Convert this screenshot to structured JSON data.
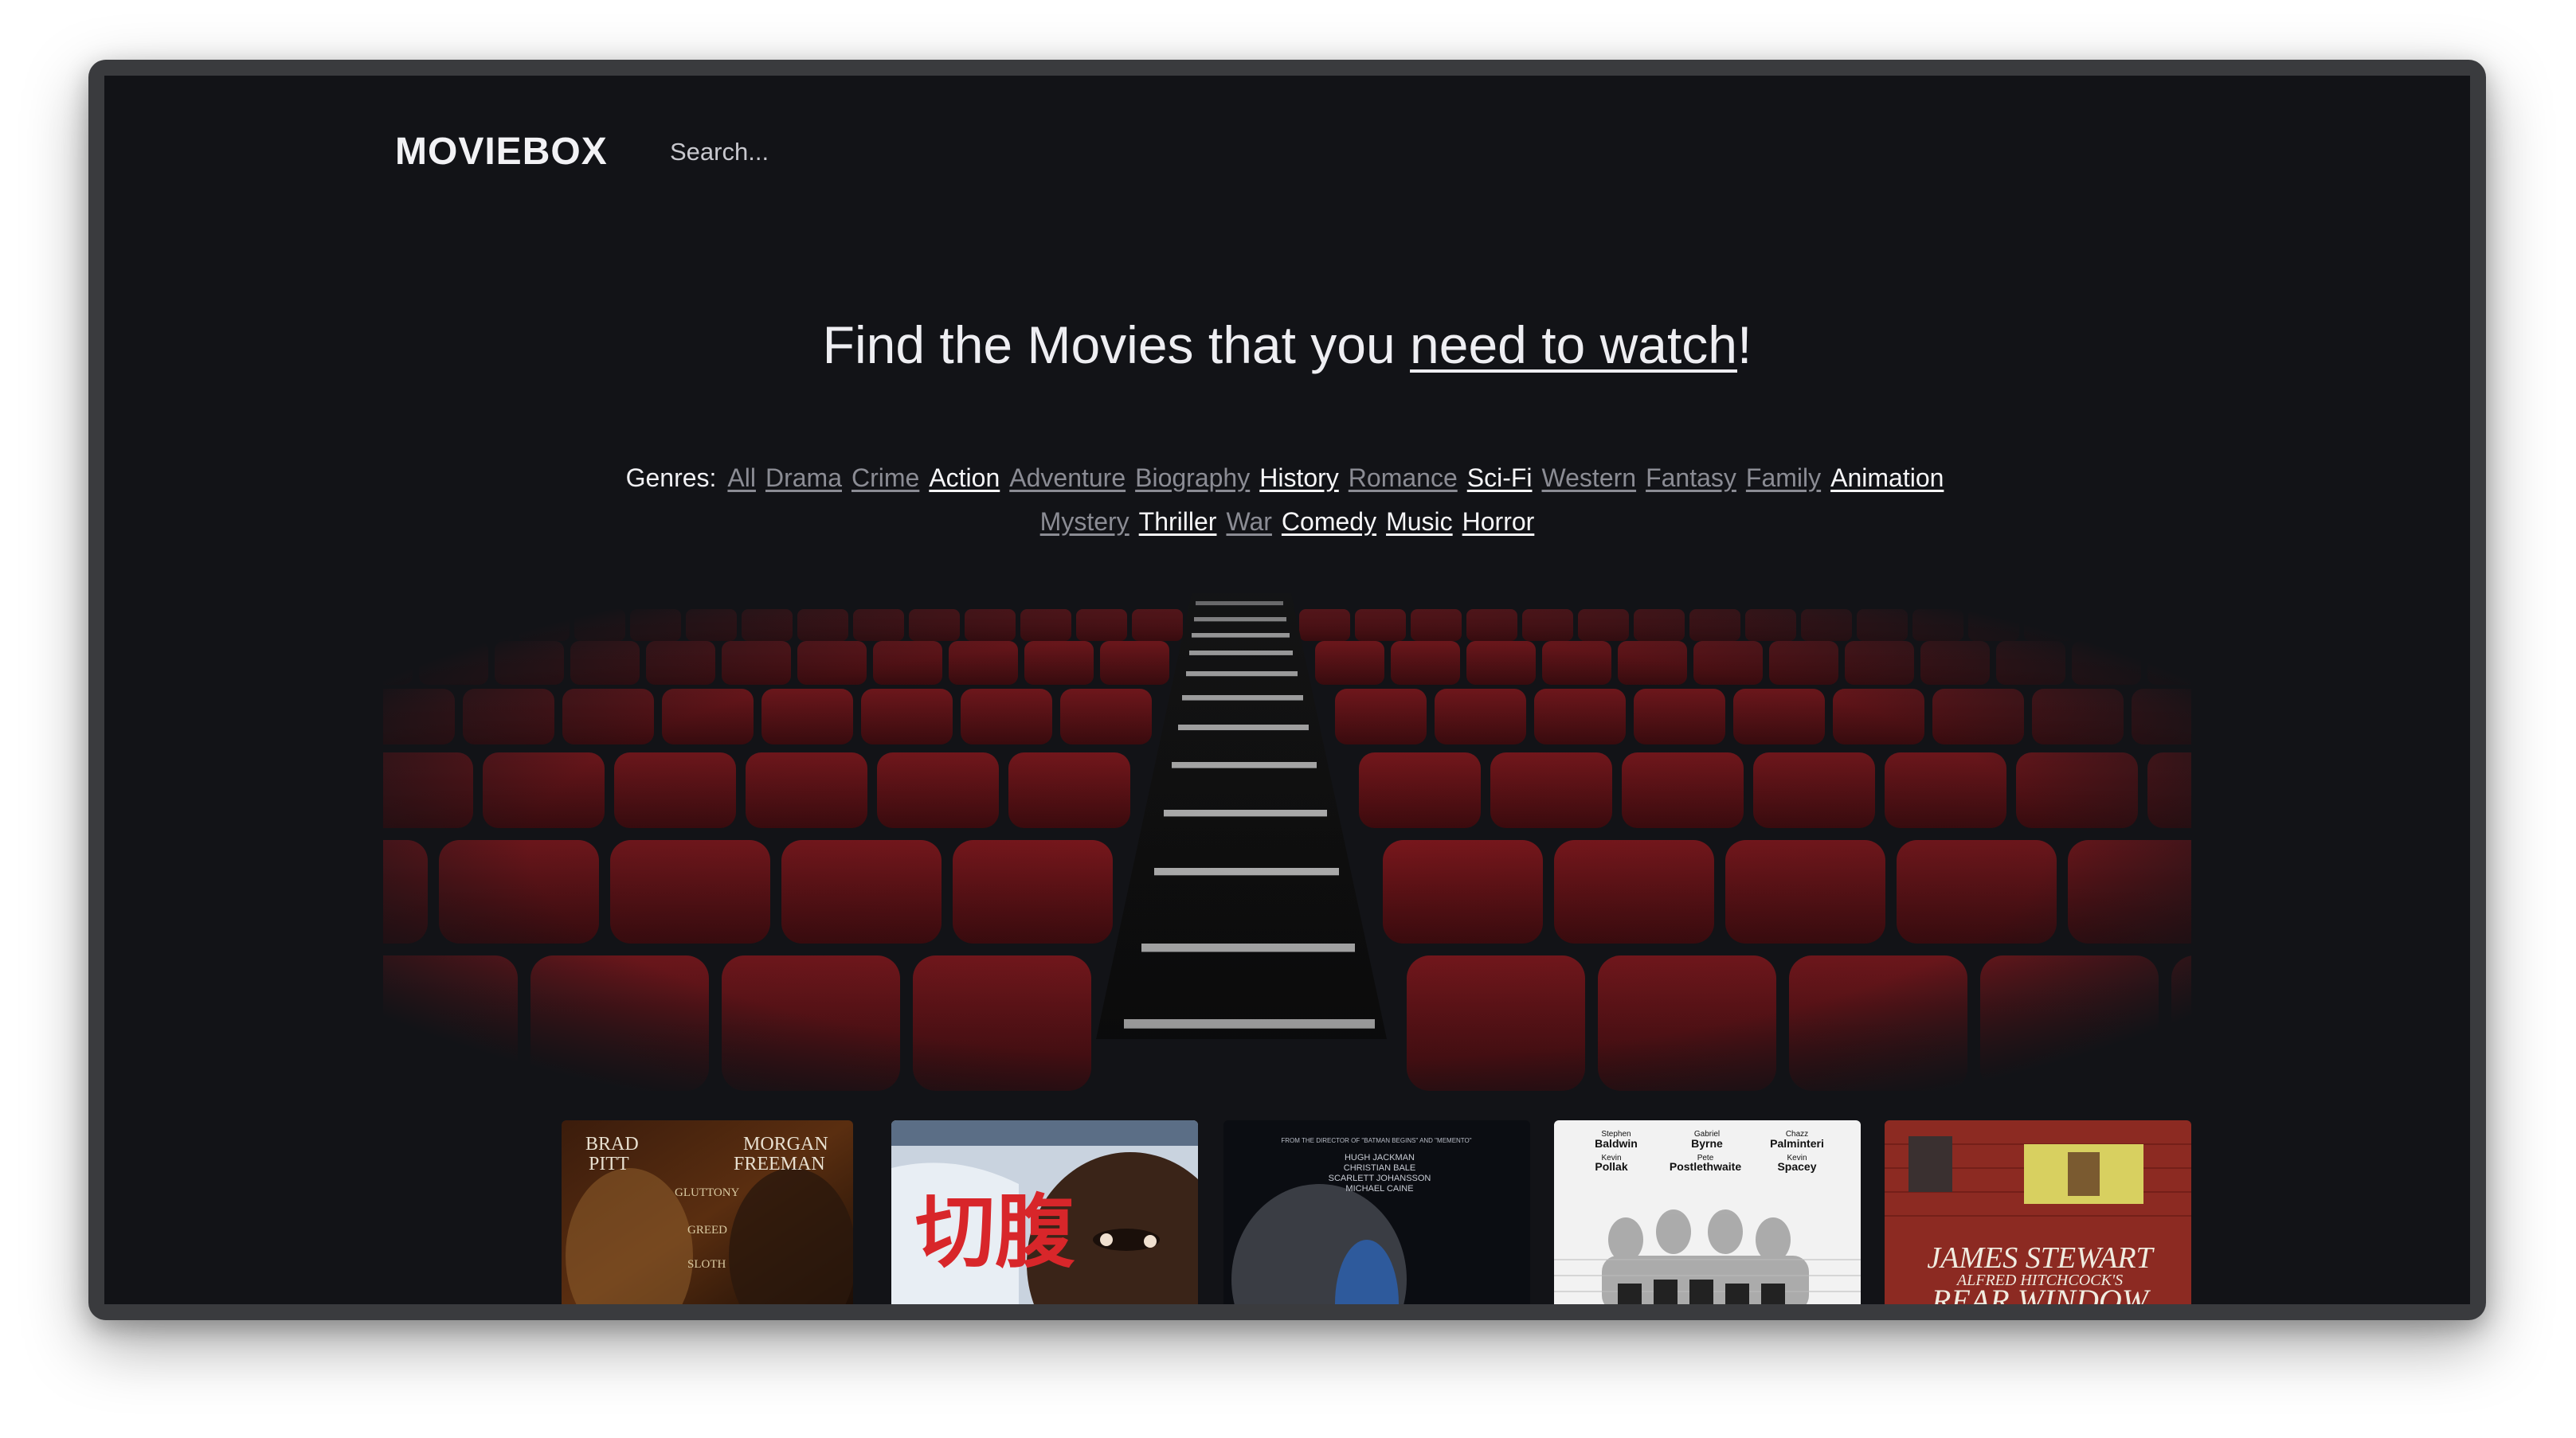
{
  "app": {
    "logo": "MOVIEBOX"
  },
  "search": {
    "placeholder": "Search..."
  },
  "hero": {
    "title_prefix": "Find the Movies that you ",
    "title_link": "need to watch",
    "title_suffix": "!"
  },
  "genres": {
    "label": "Genres:",
    "items": [
      {
        "label": "All",
        "state": "dim"
      },
      {
        "label": "Drama",
        "state": "dim"
      },
      {
        "label": "Crime",
        "state": "dim"
      },
      {
        "label": "Action",
        "state": "bright"
      },
      {
        "label": "Adventure",
        "state": "dim"
      },
      {
        "label": "Biography",
        "state": "dim"
      },
      {
        "label": "History",
        "state": "bright"
      },
      {
        "label": "Romance",
        "state": "dim"
      },
      {
        "label": "Sci-Fi",
        "state": "bright"
      },
      {
        "label": "Western",
        "state": "dim"
      },
      {
        "label": "Fantasy",
        "state": "dim"
      },
      {
        "label": "Family",
        "state": "dim"
      },
      {
        "label": "Animation",
        "state": "bright"
      },
      {
        "label": "Mystery",
        "state": "dim"
      },
      {
        "label": "Thriller",
        "state": "bright"
      },
      {
        "label": "War",
        "state": "dim"
      },
      {
        "label": "Comedy",
        "state": "bright"
      },
      {
        "label": "Music",
        "state": "bright"
      },
      {
        "label": "Horror",
        "state": "bright"
      }
    ]
  },
  "posters": [
    {
      "id": "se7en",
      "top_left": "BRAD",
      "top_left_2": "PITT",
      "top_right": "MORGAN",
      "top_right_2": "FREEMAN",
      "sins": [
        "GLUTTONY",
        "GREED",
        "SLOTH"
      ]
    },
    {
      "id": "harakiri",
      "text": "切腹"
    },
    {
      "id": "prestige",
      "tagline": "FROM THE DIRECTOR OF \"BATMAN BEGINS\" AND \"MEMENTO\"",
      "cast": [
        "HUGH JACKMAN",
        "CHRISTIAN BALE",
        "SCARLETT JOHANSSON",
        "MICHAEL CAINE"
      ]
    },
    {
      "id": "usual-suspects",
      "row1": [
        "Stephen",
        "Baldwin",
        "Gabriel",
        "Byrne",
        "Chazz",
        "Palminteri"
      ],
      "row2": [
        "Kevin",
        "Pollak",
        "Pete",
        "Postlethwaite",
        "Kevin",
        "Spacey"
      ]
    },
    {
      "id": "rear-window",
      "star": "JAMES STEWART",
      "director": "ALFRED HITCHCOCK'S",
      "title": "REAR WINDOW"
    }
  ],
  "colors": {
    "background": "#121317",
    "seat_red": "#6b1418",
    "text": "#eeeef2",
    "genre_dim": "#8b8c94"
  }
}
